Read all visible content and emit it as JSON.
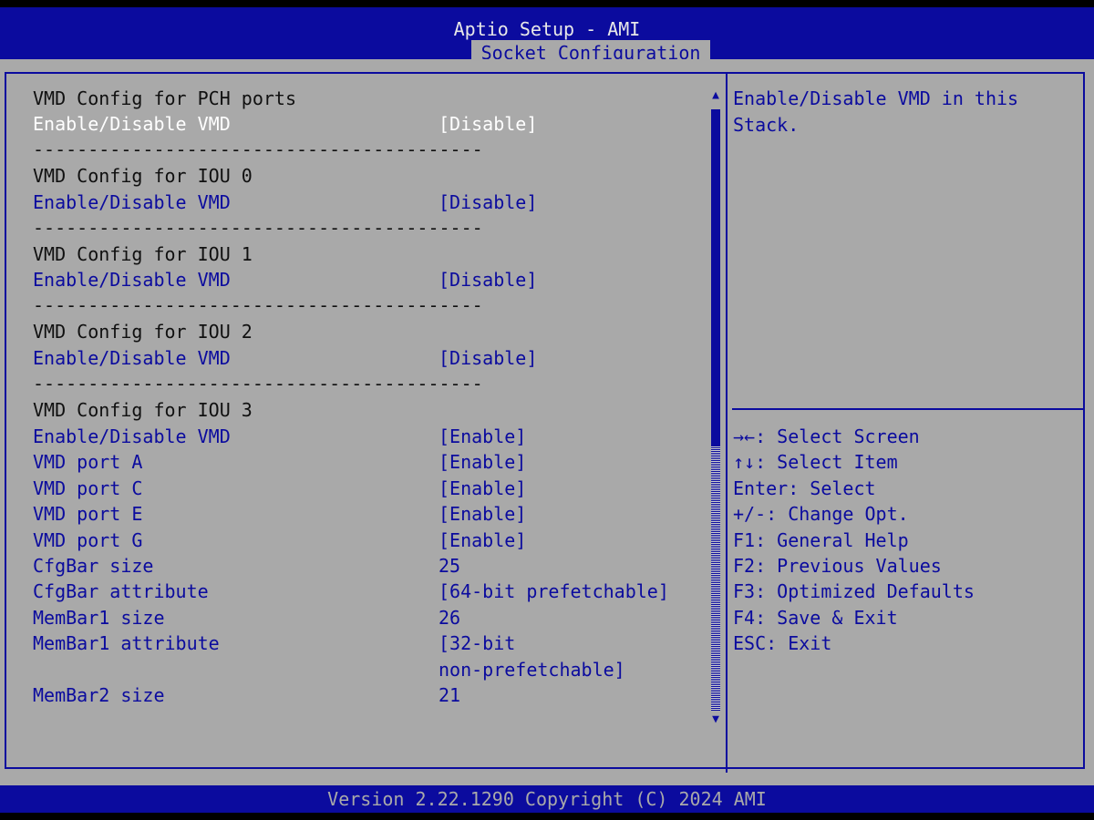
{
  "header": {
    "title": "Aptio Setup - AMI",
    "active_tab": "Socket Configuration"
  },
  "settings": {
    "pch_title": "VMD Config for PCH ports",
    "pch_vmd_label": "Enable/Disable VMD",
    "pch_vmd_value": "[Disable]",
    "sep1": "-----------------------------------------",
    "iou0_title": "VMD Config for IOU 0",
    "iou0_vmd_label": "Enable/Disable VMD",
    "iou0_vmd_value": "[Disable]",
    "sep2": "-----------------------------------------",
    "iou1_title": "VMD Config for IOU 1",
    "iou1_vmd_label": "Enable/Disable VMD",
    "iou1_vmd_value": "[Disable]",
    "sep3": "-----------------------------------------",
    "iou2_title": "VMD Config for IOU 2",
    "iou2_vmd_label": "Enable/Disable VMD",
    "iou2_vmd_value": "[Disable]",
    "sep4": "-----------------------------------------",
    "iou3_title": "VMD Config for IOU 3",
    "iou3_vmd_label": "Enable/Disable VMD",
    "iou3_vmd_value": "[Enable]",
    "port_a_label": "VMD port A",
    "port_a_value": "[Enable]",
    "port_c_label": "VMD port C",
    "port_c_value": "[Enable]",
    "port_e_label": "VMD port E",
    "port_e_value": "[Enable]",
    "port_g_label": "VMD port G",
    "port_g_value": "[Enable]",
    "cfgbar_size_label": "CfgBar size",
    "cfgbar_size_value": "25",
    "cfgbar_attr_label": "CfgBar attribute",
    "cfgbar_attr_value": "[64-bit prefetchable]",
    "membar1_size_label": "MemBar1 size",
    "membar1_size_value": "26",
    "membar1_attr_label": "MemBar1 attribute",
    "membar1_attr_value_line1": "[32-bit",
    "membar1_attr_value_line2": "non-prefetchable]",
    "membar2_size_label": "MemBar2 size",
    "membar2_size_value": "21"
  },
  "scrollbar": {
    "up_arrow": "▲",
    "down_arrow": "▼",
    "thumb_fraction": 0.56
  },
  "help": {
    "text": "Enable/Disable VMD in this\nStack."
  },
  "keys": {
    "select_screen": "→←: Select Screen",
    "select_item": "↑↓: Select Item",
    "enter": "Enter: Select",
    "change_opt": "+/-: Change Opt.",
    "f1": "F1: General Help",
    "f2": "F2: Previous Values",
    "f3": "F3: Optimized Defaults",
    "f4": "F4: Save & Exit",
    "esc": "ESC: Exit"
  },
  "footer": {
    "version": "Version 2.22.1290 Copyright (C) 2024 AMI"
  },
  "colors": {
    "blue": "#0b0b9e",
    "gray": "#a9a9a9",
    "selected_text": "#ffffff"
  }
}
